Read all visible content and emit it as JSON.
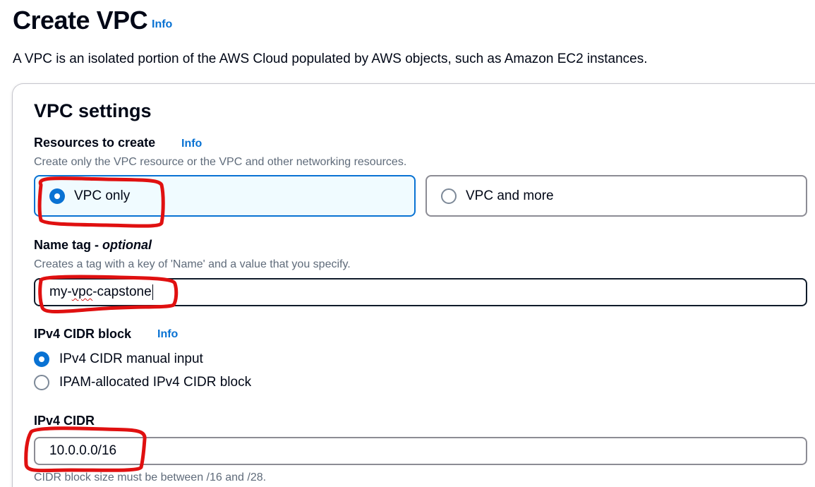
{
  "header": {
    "title": "Create VPC",
    "info": "Info",
    "description": "A VPC is an isolated portion of the AWS Cloud populated by AWS objects, such as Amazon EC2 instances."
  },
  "vpc_settings": {
    "title": "VPC settings",
    "resources": {
      "label": "Resources to create",
      "info": "Info",
      "hint": "Create only the VPC resource or the VPC and other networking resources.",
      "options": [
        {
          "label": "VPC only",
          "selected": true
        },
        {
          "label": "VPC and more",
          "selected": false
        }
      ]
    },
    "name_tag": {
      "label": "Name tag - ",
      "optional": "optional",
      "hint": "Creates a tag with a key of 'Name' and a value that you specify.",
      "value_prefix": "my-",
      "value_misspelled": "vpc",
      "value_suffix": "-capstone"
    },
    "ipv4_cidr_block": {
      "label": "IPv4 CIDR block",
      "info": "Info",
      "options": [
        {
          "label": "IPv4 CIDR manual input",
          "selected": true
        },
        {
          "label": "IPAM-allocated IPv4 CIDR block",
          "selected": false
        }
      ]
    },
    "ipv4_cidr": {
      "label": "IPv4 CIDR",
      "value": "10.0.0.0/16",
      "hint": "CIDR block size must be between /16 and /28."
    }
  },
  "colors": {
    "link": "#0972d3",
    "selected_border": "#0972d3",
    "selected_bg": "#f0fbff",
    "annotation": "#e01010"
  }
}
